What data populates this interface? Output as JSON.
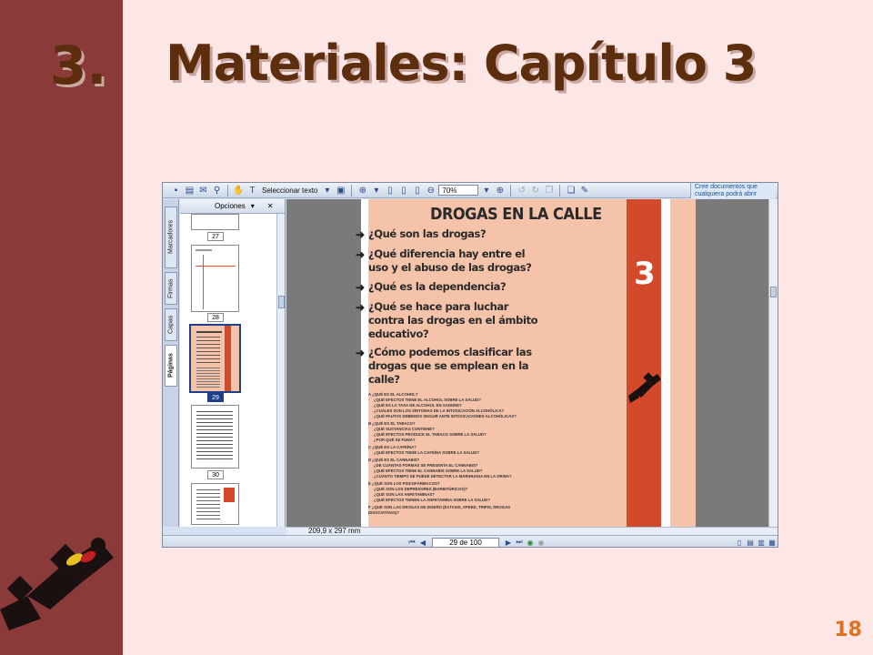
{
  "slide": {
    "number": "3.",
    "title": "Materiales: Capítulo 3",
    "page_number": "18"
  },
  "toolbar": {
    "select_text_label": "Seleccionar texto",
    "zoom_value": "70%",
    "promo_text": "Cree documentos que cualquiera podrá abrir"
  },
  "side_tabs": [
    "Marcadores",
    "Firmas",
    "Capas",
    "Páginas"
  ],
  "thumbnails": {
    "options_label": "Opciones",
    "labels": [
      "27",
      "28",
      "29",
      "30"
    ]
  },
  "document": {
    "title": "DROGAS EN LA CALLE",
    "chapter_number": "3",
    "questions": [
      "¿Qué son las drogas?",
      "¿Qué diferencia hay entre el uso y el abuso de las drogas?",
      "¿Qué es la dependencia?",
      "¿Qué se hace para luchar contra las drogas en el ámbito educativo?",
      "¿Cómo podemos clasificar las drogas que se emplean en la calle?"
    ],
    "subtopics": [
      "A ¿QUÉ ES EL ALCOHOL?",
      "¿QUÉ EFECTOS TIENE EL ALCOHOL SOBRE LA SALUD?",
      "¿QUÉ ES LA TASA DE ALCOHOL EN SANGRE?",
      "¿CUÁLES SON LOS SÍNTOMAS DE LA INTOXICACIÓN ALCOHÓLICA?",
      "¿QUÉ PAUTAS DEBEMOS SEGUIR ANTE INTOXICACIONES ALCOHÓLICAS?",
      "B ¿QUÉ ES EL TABACO?",
      "¿QUÉ SUSTANCIAS CONTIENE?",
      "¿QUÉ EFECTOS PRODUCE EL TABACO SOBRE LA SALUD?",
      "¿POR QUÉ SE FUMA?",
      "C ¿QUÉ ES LA CAFEÍNA?",
      "¿QUÉ EFECTOS TIENE LA CAFEÍNA SOBRE LA SALUD?",
      "D ¿QUÉ ES EL CANNABIS?",
      "¿DE CUÁNTAS FORMAS SE PRESENTA EL CANNABIS?",
      "¿QUÉ EFECTOS TIENE EL CANNABIS SOBRE LA SALUD?",
      "¿CUÁNTO TIEMPO SE PUEDE DETECTAR LA MARIHUANA EN LA ORINA?",
      "E ¿QUÉ SON LOS PSICOFÁRMACOS?",
      "¿QUÉ SON LOS DEPRESORES (BARBITÚRICOS)?",
      "¿QUÉ SON LAS ANFETAMINAS?",
      "¿QUÉ EFECTOS TIENEN LA ANFETAMINA SOBRE LA SALUD?",
      "F ¿QUÉ SON LAS DROGAS DE DISEÑO (ÉXTASIS, SPEED, TRIPIS, DROGAS DISOCIATIVAS)?"
    ]
  },
  "status": {
    "page_size": "209,9 x 297 mm",
    "page_indicator": "29 de 100"
  },
  "colors": {
    "left_bar": "#8b3a3a",
    "title": "#5c2e0e",
    "page_number": "#e07020",
    "doc_bg": "#f5c3aa",
    "strip": "#d24a2a"
  }
}
